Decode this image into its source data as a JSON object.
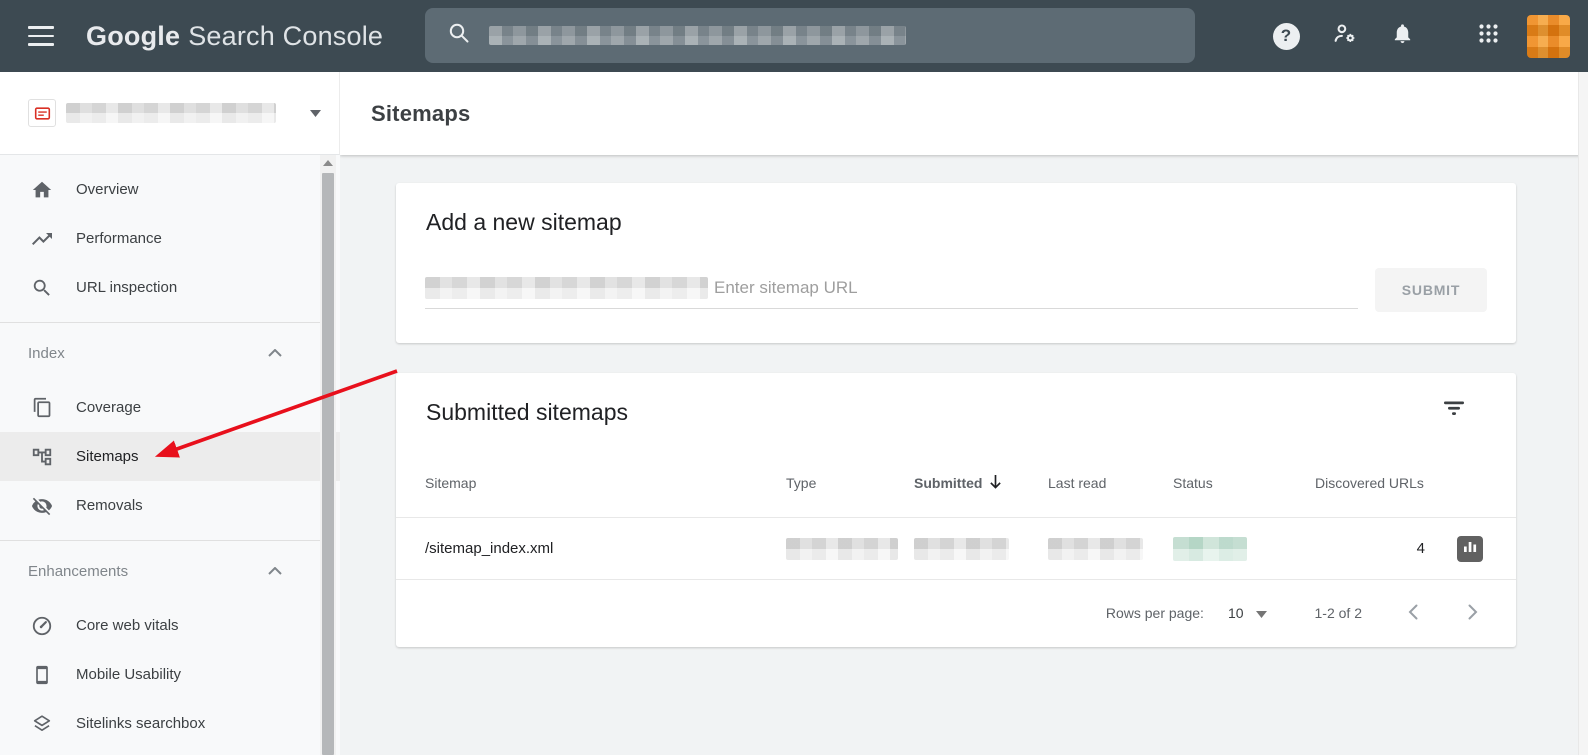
{
  "topbar": {
    "logo_primary": "Google",
    "logo_secondary": "Search Console",
    "help_glyph": "?"
  },
  "sidebar": {
    "nav": [
      {
        "label": "Overview"
      },
      {
        "label": "Performance"
      },
      {
        "label": "URL inspection"
      }
    ],
    "sections": [
      {
        "label": "Index"
      },
      {
        "label": "Enhancements"
      }
    ],
    "index_items": [
      {
        "label": "Coverage"
      },
      {
        "label": "Sitemaps",
        "active": true
      },
      {
        "label": "Removals"
      }
    ],
    "enhancement_items": [
      {
        "label": "Core web vitals"
      },
      {
        "label": "Mobile Usability"
      },
      {
        "label": "Sitelinks searchbox"
      }
    ]
  },
  "page": {
    "title": "Sitemaps"
  },
  "add_sitemap_card": {
    "title": "Add a new sitemap",
    "input_placeholder": "Enter sitemap URL",
    "submit_label": "SUBMIT"
  },
  "submitted_card": {
    "title": "Submitted sitemaps",
    "columns": [
      "Sitemap",
      "Type",
      "Submitted",
      "Last read",
      "Status",
      "Discovered URLs"
    ],
    "rows": [
      {
        "sitemap": "/sitemap_index.xml",
        "discovered_urls": "4"
      }
    ],
    "pagination": {
      "rows_per_page_label": "Rows per page:",
      "rows_per_page_value": "10",
      "range": "1-2 of 2"
    }
  },
  "colors": {
    "topbar_bg": "#3d4a52",
    "accent_red": "#e8101c",
    "avatar_orange": "#ef8a1c",
    "redacted_status_green": "#c9e3d8",
    "active_nav_bg": "#ececec"
  }
}
